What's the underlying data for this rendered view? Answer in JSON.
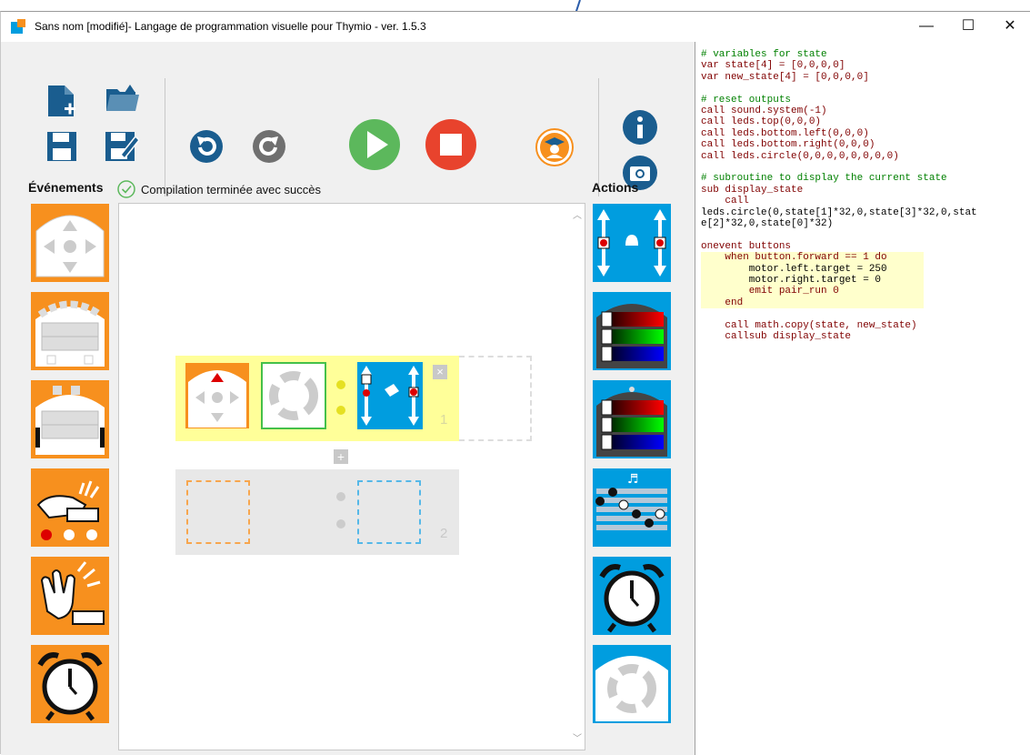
{
  "window": {
    "title": "Sans nom [modifié]- Langage de programmation visuelle pour Thymio - ver. 1.5.3",
    "controls": [
      "—",
      "☐",
      "✕"
    ]
  },
  "toolbar": {
    "icons": [
      "new-file-icon",
      "open-file-icon",
      "save-icon",
      "save-as-icon",
      "undo-icon",
      "redo-icon",
      "run-icon",
      "stop-icon",
      "advanced-mode-icon",
      "info-icon",
      "screenshot-icon"
    ],
    "colors": {
      "dark_blue": "#1a5d8f",
      "green": "#5cb85c",
      "red": "#e8432d",
      "orange": "#f7901e",
      "blue": "#009ddf"
    }
  },
  "labels": {
    "events": "Événements",
    "actions": "Actions",
    "status": "Compilation terminée avec succès"
  },
  "rows": [
    {
      "number": "1"
    },
    {
      "number": "2"
    }
  ],
  "code": {
    "lines": [
      "# variables for state",
      "var state[4] = [0,0,0,0]",
      "var new_state[4] = [0,0,0,0]",
      "",
      "# reset outputs",
      "call sound.system(-1)",
      "call leds.top(0,0,0)",
      "call leds.bottom.left(0,0,0)",
      "call leds.bottom.right(0,0,0)",
      "call leds.circle(0,0,0,0,0,0,0,0)",
      "",
      "# subroutine to display the current state",
      "sub display_state",
      "    call",
      "leds.circle(0,state[1]*32,0,state[3]*32,0,stat",
      "e[2]*32,0,state[0]*32)",
      "",
      "onevent buttons",
      "    when button.forward == 1 do",
      "        motor.left.target = 250",
      "        motor.right.target = 0",
      "        emit pair_run 0",
      "    end",
      "",
      "    call math.copy(state, new_state)",
      "    callsub display_state"
    ]
  }
}
